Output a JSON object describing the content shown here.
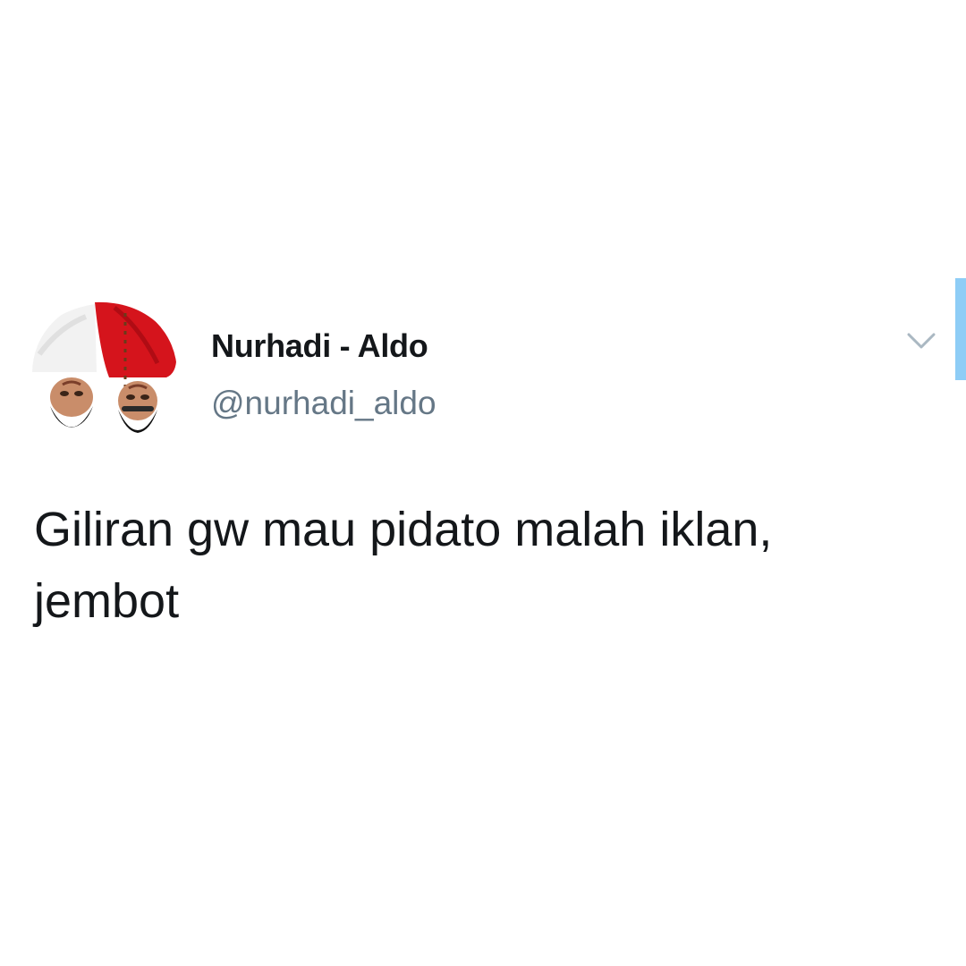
{
  "tweet": {
    "author": {
      "display_name": "Nurhadi - Aldo",
      "handle": "@nurhadi_aldo",
      "avatar": "avatar-image"
    },
    "text": "Giliran gw mau pidato malah iklan,\njembot",
    "menu_icon": "chevron-down-icon"
  },
  "colors": {
    "text_primary": "#14171a",
    "text_secondary": "#657786",
    "scroll_indicator": "#8ecdf6",
    "background": "#ffffff"
  }
}
